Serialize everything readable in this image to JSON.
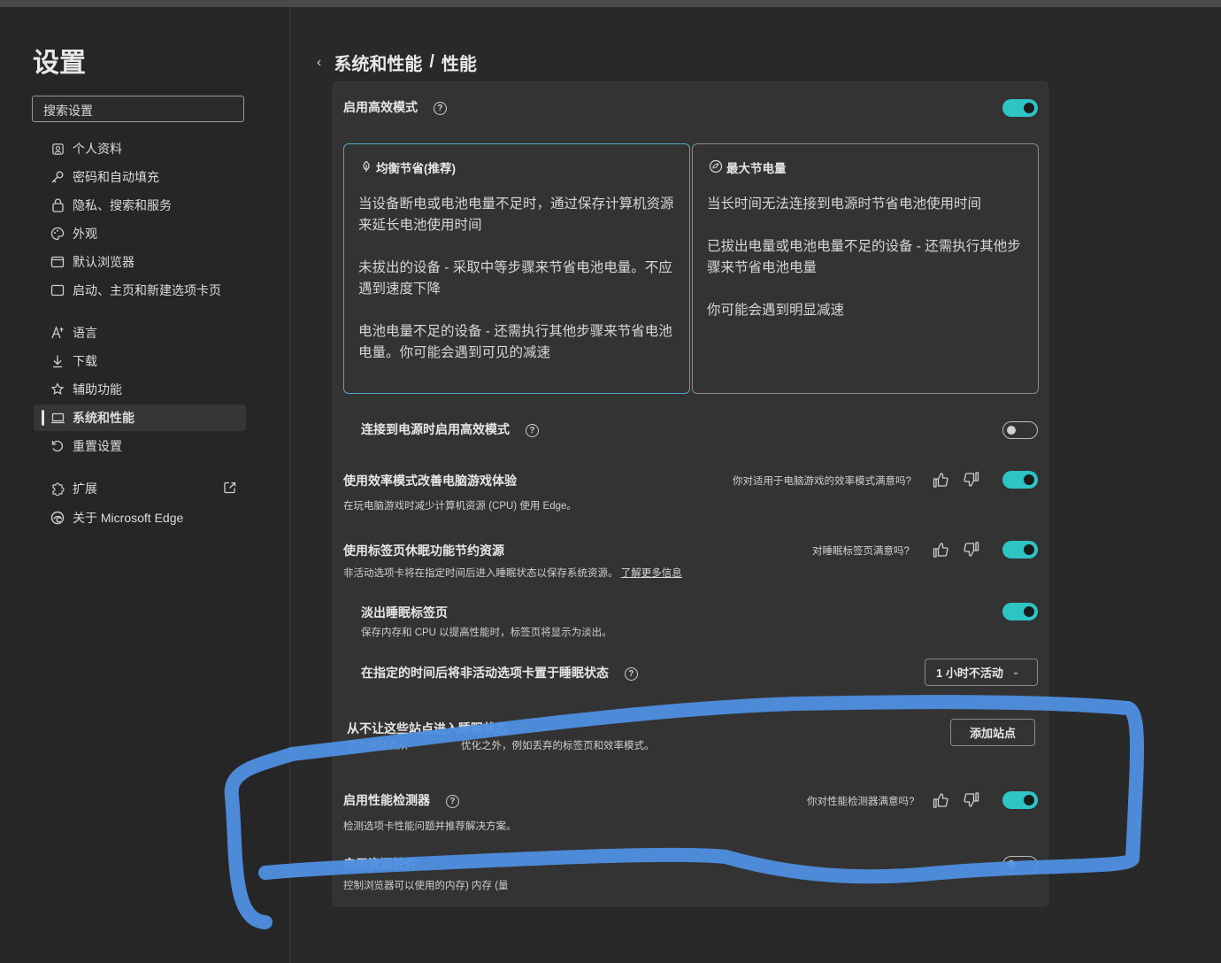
{
  "sidebar": {
    "title": "设置",
    "search_placeholder": "搜索设置",
    "items": [
      {
        "label": "个人资料",
        "icon": "profile-icon"
      },
      {
        "label": "密码和自动填充",
        "icon": "key-icon"
      },
      {
        "label": "隐私、搜索和服务",
        "icon": "lock-icon"
      },
      {
        "label": "外观",
        "icon": "palette-icon"
      },
      {
        "label": "默认浏览器",
        "icon": "browser-icon"
      },
      {
        "label": "启动、主页和新建选项卡页",
        "icon": "home-icon"
      },
      {
        "label": "语言",
        "icon": "language-icon"
      },
      {
        "label": "下载",
        "icon": "download-icon"
      },
      {
        "label": "辅助功能",
        "icon": "accessibility-icon"
      },
      {
        "label": "系统和性能",
        "icon": "laptop-icon",
        "active": true
      },
      {
        "label": "重置设置",
        "icon": "reset-icon"
      },
      {
        "label": "扩展",
        "icon": "puzzle-icon"
      },
      {
        "label": "关于 Microsoft Edge",
        "icon": "edge-icon"
      }
    ]
  },
  "breadcrumb": {
    "parent": "系统和性能",
    "separator": "/",
    "current": "性能"
  },
  "efficiency": {
    "label": "启用高效模式",
    "enabled": true,
    "modes": [
      {
        "title": "均衡节省(推荐)",
        "selected": true,
        "paragraphs": [
          "当设备断电或电池电量不足时，通过保存计算机资源来延长电池使用时间",
          "未拔出的设备 - 采取中等步骤来节省电池电量。不应遇到速度下降",
          "电池电量不足的设备 - 还需执行其他步骤来节省电池电量。你可能会遇到可见的减速"
        ]
      },
      {
        "title": "最大节电量",
        "selected": false,
        "paragraphs": [
          "当长时间无法连接到电源时节省电池使用时间",
          "已拔出电量或电池电量不足的设备 - 还需执行其他步骤来节省电池电量",
          "你可能会遇到明显减速"
        ]
      }
    ]
  },
  "plugged_in": {
    "label": "连接到电源时启用高效模式",
    "enabled": false
  },
  "gaming": {
    "label": "使用效率模式改善电脑游戏体验",
    "desc": "在玩电脑游戏时减少计算机资源 (CPU) 使用 Edge。",
    "feedback": "你对适用于电脑游戏的效率模式满意吗?",
    "enabled": true
  },
  "sleeping_tabs": {
    "label": "使用标签页休眠功能节约资源",
    "desc": "非活动选项卡将在指定时间后进入睡眠状态以保存系统资源。",
    "link": "了解更多信息",
    "feedback": "对睡眠标签页满意吗?",
    "enabled": true
  },
  "fade_tabs": {
    "label": "淡出睡眠标签页",
    "desc": "保存内存和 CPU 以提高性能时，标签页将显示为淡出。",
    "enabled": true
  },
  "sleep_after": {
    "label": "在指定的时间后将非活动选项卡置于睡眠状态",
    "value": "1 小时不活动"
  },
  "never_sleep": {
    "label": "从不让这些站点进入睡眠状态",
    "desc_visible": "这会将站点从",
    "desc_tail": "优化之外，例如丢弃的标签页和效率模式。",
    "button": "添加站点"
  },
  "perf_detector": {
    "label": "启用性能检测器",
    "desc": "检测选项卡性能问题并推荐解决方案。",
    "feedback": "你对性能检测器满意吗?",
    "enabled": true
  },
  "resource_controls": {
    "label": "启用资源控件",
    "desc": "控制浏览器可以使用的内存) 内存 (量",
    "enabled": false
  },
  "colors": {
    "accent_toggle": "#2ec4c4",
    "scribble": "#4f8fe0"
  }
}
